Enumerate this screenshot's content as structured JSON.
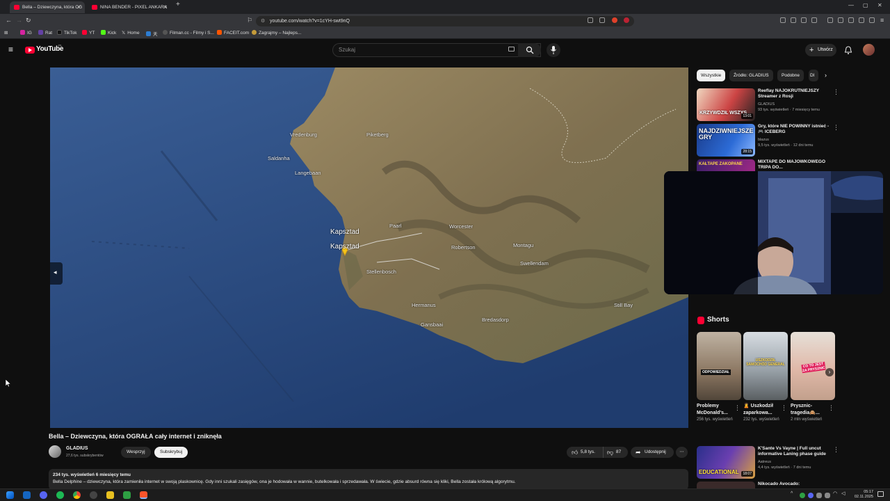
{
  "browser": {
    "tabs": [
      {
        "title": "Bella – Dziewczyna, która OG"
      },
      {
        "title": "NINA BENDER - PIXEL ANKARA"
      }
    ],
    "url": "youtube.com/watch?v=1cYH-swt9nQ",
    "bookmarks": [
      "IG",
      "Rat",
      "TikTok",
      "YT",
      "Kick",
      "Home",
      "天",
      "Filman.cc - Filmy i S...",
      "FACEIT.com",
      "Zagrajmy – Najleps..."
    ]
  },
  "youtube": {
    "logo": "YouTube",
    "logo_region": "PL",
    "search_placeholder": "Szukaj",
    "create_label": "Utwórz",
    "chips": [
      "Wszystkie",
      "Źródło: GLADIUS",
      "Podobne",
      "Dl"
    ],
    "recommendations": [
      {
        "title": "Reeflay NAJOKRUTNIEJSZY Streamer z Rosji",
        "channel": "GLADIUS",
        "meta": "93 tys. wyświetleń · 7 miesięcy temu",
        "duration": "13:01",
        "thumb_text": "KRZYWDZIŁ WSZYS..."
      },
      {
        "title": "Gry, które NIE POWINNY istnieć - 🎮 ICEBERG",
        "channel": "blazus",
        "meta": "9,5 tys. wyświetleń · 12 dni temu",
        "duration": "28:15",
        "thumb_text": "NAJDZIWNIEJSZE GRY"
      },
      {
        "title": "MIXTAPE DO MAJÓWKOWEGO TRIPA DO...",
        "channel": "",
        "meta": "",
        "duration": "",
        "thumb_text": "KAŁTAPE ZAKOPANE"
      }
    ],
    "shorts_heading": "Shorts",
    "shorts": [
      {
        "title": "Problemy McDonald's...",
        "views": "256 tys. wyświetleń",
        "overlay": "ODPOWIEDZIAŁ"
      },
      {
        "title": "🙎 Uszkodził zaparkowa...",
        "views": "232 tys. wyświetleń",
        "overlay": "USZKODZIŁ SAMOCHÓD GENERAL"
      },
      {
        "title": "Prysznic-tragedia🙈...",
        "views": "2 mln wyświetleń",
        "overlay": "CO TO JEST ZA PRYSZNIC"
      }
    ],
    "bottom_recs": [
      {
        "title": "K'Sante Vs Vayne | Full uncut informative Laning phase guide",
        "channel": "Aatreus",
        "meta": "4,4 tys. wyświetleń · 7 dni temu",
        "duration": "18:07",
        "thumb_text": "EDUCATIONAL"
      },
      {
        "title": "Nikocado Avocado:",
        "channel": "",
        "meta": "",
        "duration": "",
        "thumb_text": ""
      }
    ]
  },
  "map": {
    "labels": [
      "Vredenburg",
      "Piketberg",
      "Saldanha",
      "Langebaan",
      "Kapsztad",
      "Kapsztad",
      "Paarl",
      "Worcester",
      "Robertson",
      "Montagu",
      "Stellenbosch",
      "Swellendam",
      "Hermanus",
      "Gansbaai",
      "Bredasdorp",
      "Still Bay"
    ]
  },
  "video": {
    "title": "Bella – Dziewczyna, która OGRAŁA cały internet i zniknęła",
    "channel": "GLADIUS",
    "subscribers": "27,6 tys. subskrybentów",
    "support_label": "Wesprzyj",
    "subscribe_label": "Subskrybuj",
    "likes": "5,8 tys.",
    "dislikes": "87",
    "share_label": "Udostępnij",
    "views_line": "234 tys. wyświetleń  6 miesięcy temu",
    "description": "Bella Delphine – dziewczyna, która zamieniła internet w swoją plaskownicę. Gdy inni szukali zasięgów, ona je hodowała w wannie, butelkowała i sprzedawała. W świecie, gdzie absurd równa się kliki, Bella została królową algorytmu."
  },
  "taskbar": {
    "time": "05:17",
    "date": "02.11.2025"
  },
  "colors": {
    "youtube_red": "#ff0033",
    "background": "#0f0f0f",
    "ocean": "#2c4a7a",
    "land": "#8a7a55"
  }
}
